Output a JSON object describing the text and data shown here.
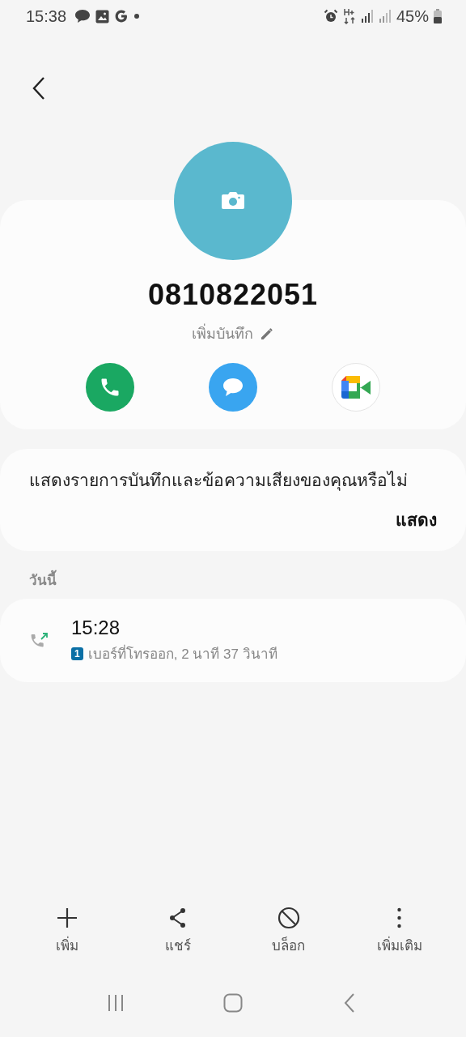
{
  "status_bar": {
    "time": "15:38",
    "battery": "45%"
  },
  "contact": {
    "number": "0810822051",
    "note_label": "เพิ่มบันทึก"
  },
  "actions": [
    {
      "kind": "call"
    },
    {
      "kind": "message"
    },
    {
      "kind": "video"
    }
  ],
  "voicemail_prompt": {
    "text": "แสดงรายการบันทึกและข้อความเสียงของคุณหรือไม่",
    "action": "แสดง"
  },
  "section_label": "วันนี้",
  "calls": [
    {
      "kind": "outgoing",
      "time": "15:28",
      "sim": "1",
      "detail": "เบอร์ที่โทรออก, 2 นาที 37 วินาที"
    }
  ],
  "bottom_actions": [
    {
      "kind": "add",
      "label": "เพิ่ม"
    },
    {
      "kind": "share",
      "label": "แชร์"
    },
    {
      "kind": "block",
      "label": "บล็อก"
    },
    {
      "kind": "more",
      "label": "เพิ่มเติม"
    }
  ]
}
